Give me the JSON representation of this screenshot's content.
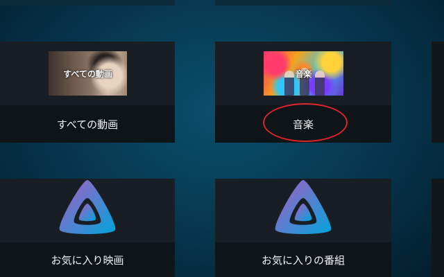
{
  "tiles": [
    {
      "id": "all-videos",
      "label": "すべての動画",
      "thumb_caption": "すべての動画",
      "thumb_type": "video-image"
    },
    {
      "id": "music",
      "label": "音楽",
      "thumb_caption": "音楽",
      "thumb_type": "music-image"
    },
    {
      "id": "favorite-movies",
      "label": "お気に入り映画",
      "thumb_type": "jellyfin-logo-icon"
    },
    {
      "id": "favorite-shows",
      "label": "お気に入りの番組",
      "thumb_type": "jellyfin-logo-icon"
    }
  ],
  "annotation": {
    "shape": "red-ellipse",
    "target": "music",
    "color": "#e0252a"
  },
  "colors": {
    "background": "#073a52",
    "tile": "#12171c",
    "label_bar": "#0f1418",
    "logo_gradient": [
      "#aa5cc3",
      "#00a4dc"
    ]
  }
}
